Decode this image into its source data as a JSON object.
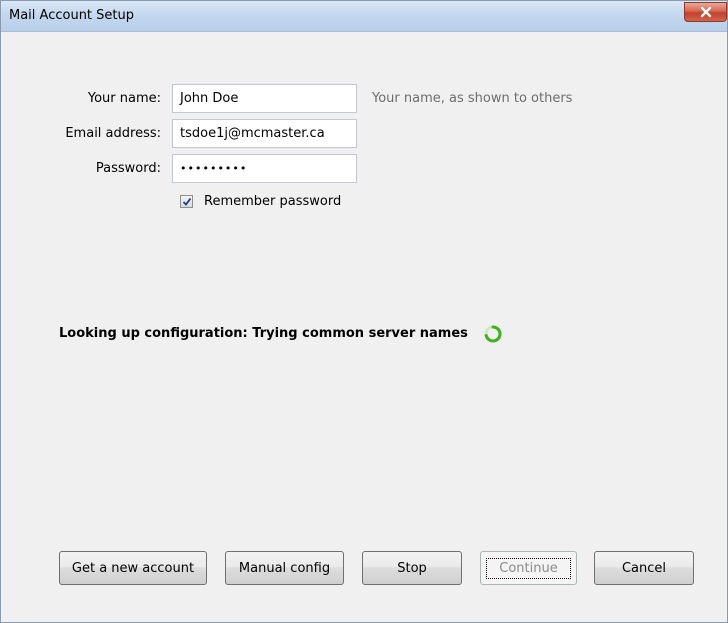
{
  "window": {
    "title": "Mail Account Setup"
  },
  "form": {
    "name_label": "Your name:",
    "name_value": "John Doe",
    "name_hint": "Your name, as shown to others",
    "email_label": "Email address:",
    "email_value": "tsdoe1j@mcmaster.ca",
    "password_label": "Password:",
    "password_masked": "•••••••••",
    "remember_label": "Remember password",
    "remember_checked": true
  },
  "status": {
    "text": "Looking up configuration: Trying common server names"
  },
  "buttons": {
    "get_new_account": "Get a new account",
    "manual_config": "Manual config",
    "stop": "Stop",
    "continue": "Continue",
    "cancel": "Cancel"
  },
  "colors": {
    "spinner": "#3fb11f",
    "hint_text": "#6d6d6d",
    "close_button": "#c2412a"
  },
  "icons": {
    "close": "close-icon",
    "checkbox": "checkmark-icon",
    "spinner": "loading-spinner-icon"
  }
}
